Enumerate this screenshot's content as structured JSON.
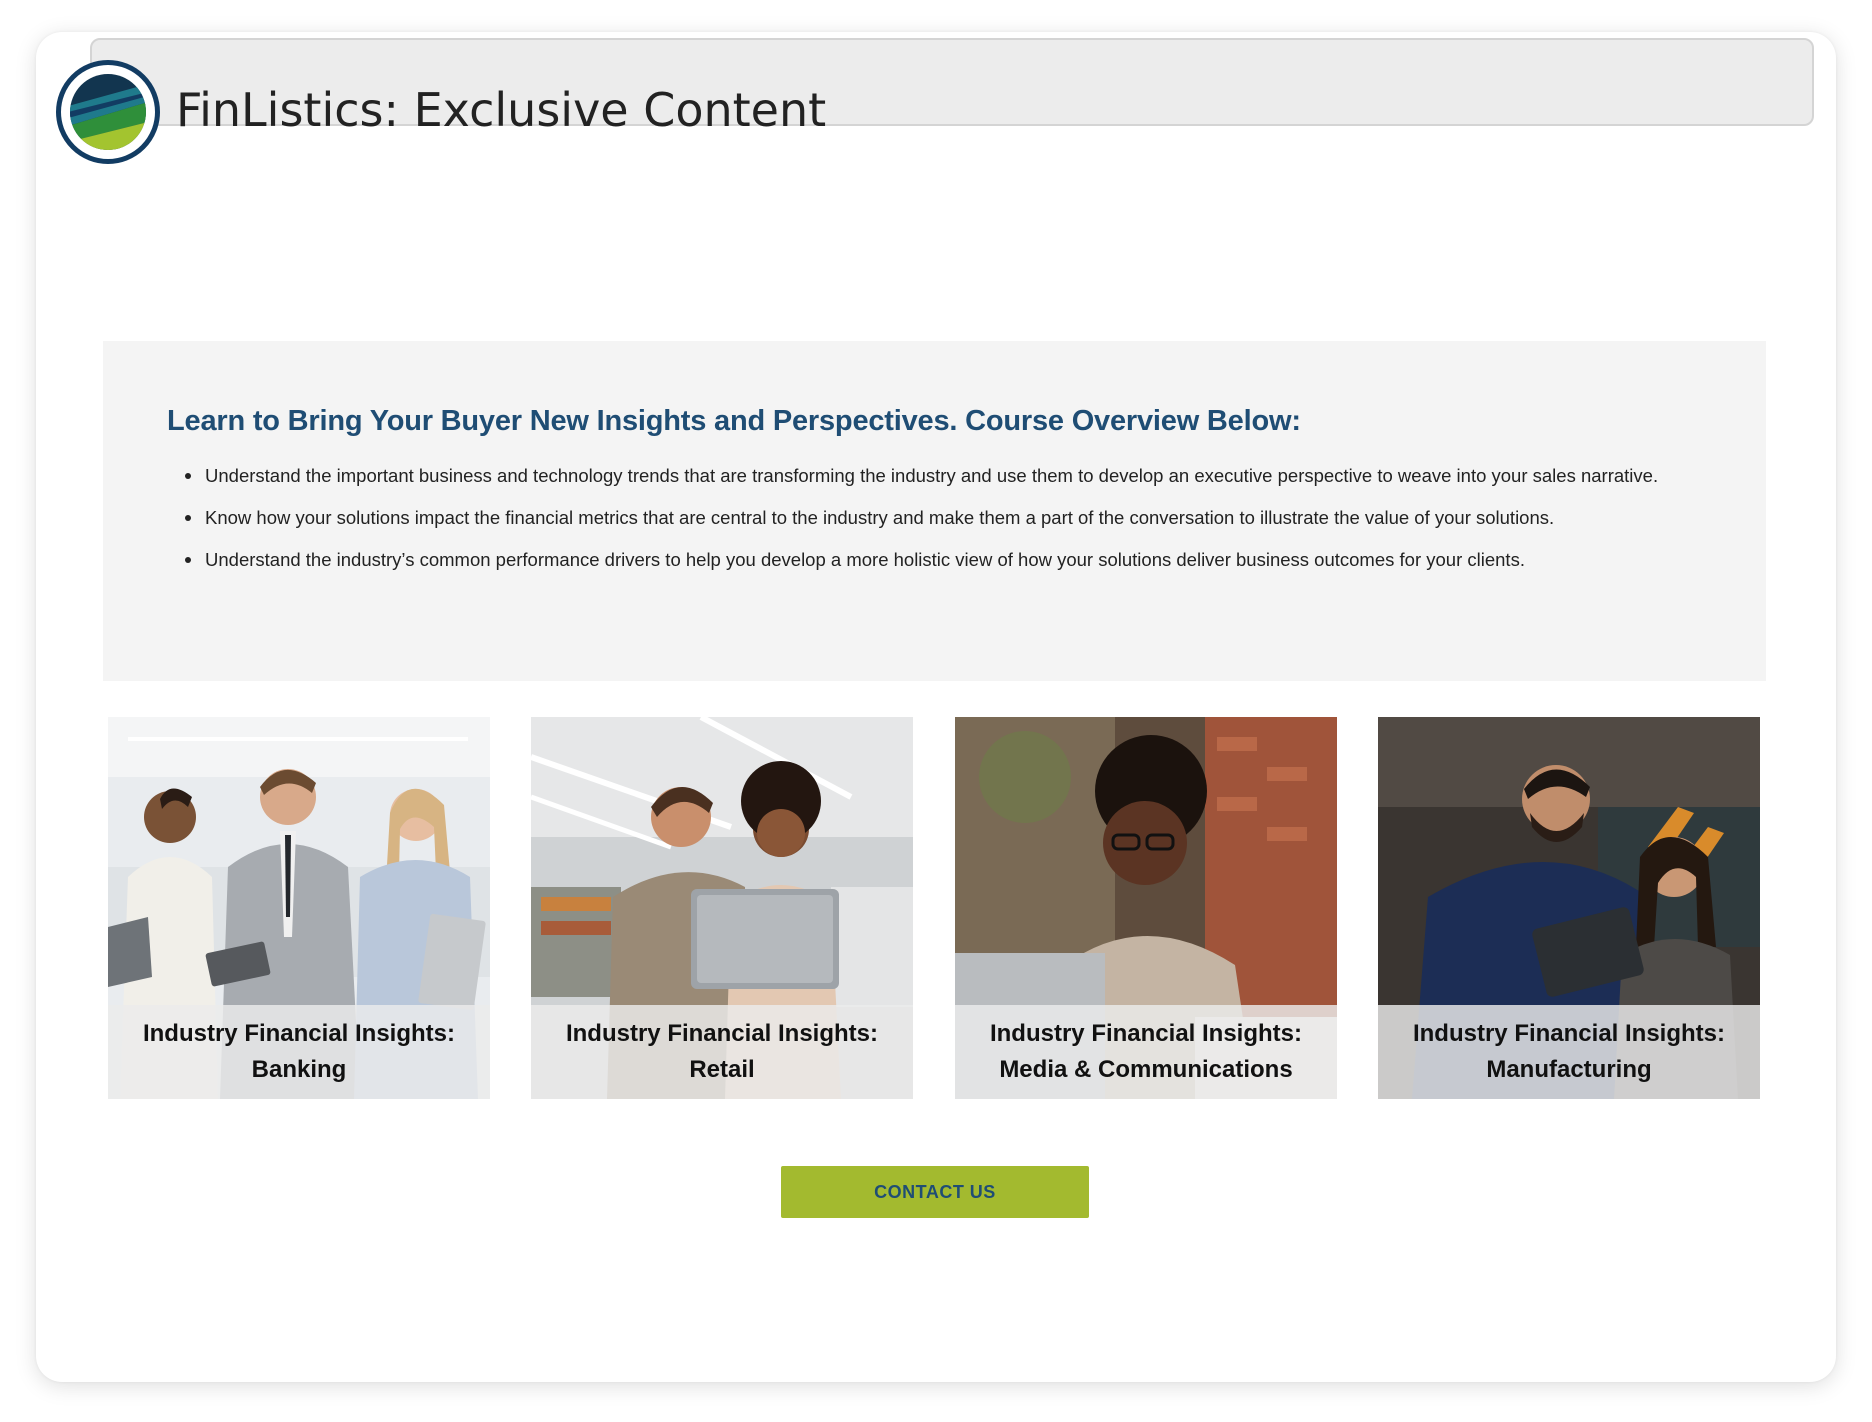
{
  "header": {
    "title": "FinListics: Exclusive Content"
  },
  "overview": {
    "heading": "Learn to Bring Your Buyer New Insights and Perspectives. Course Overview Below:",
    "bullets": [
      "Understand the important business and technology trends that are transforming the industry and use them to develop an executive perspective to weave into your sales narrative.",
      "Know how your solutions impact the financial metrics that are central to the industry and make them a part of the conversation to illustrate the value of your solutions.",
      "Understand the industry’s common performance drivers to help you develop a more holistic view of how your solutions deliver business outcomes for your clients."
    ]
  },
  "cards": [
    {
      "line1": "Industry Financial Insights:",
      "line2": "Banking"
    },
    {
      "line1": "Industry Financial Insights:",
      "line2": "Retail"
    },
    {
      "line1": "Industry Financial Insights:",
      "line2": "Media & Communications"
    },
    {
      "line1": "Industry Financial Insights:",
      "line2": "Manufacturing"
    }
  ],
  "cta": {
    "label": "CONTACT US"
  },
  "colors": {
    "brand_blue": "#1f4d74",
    "accent_green": "#a3ba2f",
    "logo_ring": "#123c63"
  }
}
